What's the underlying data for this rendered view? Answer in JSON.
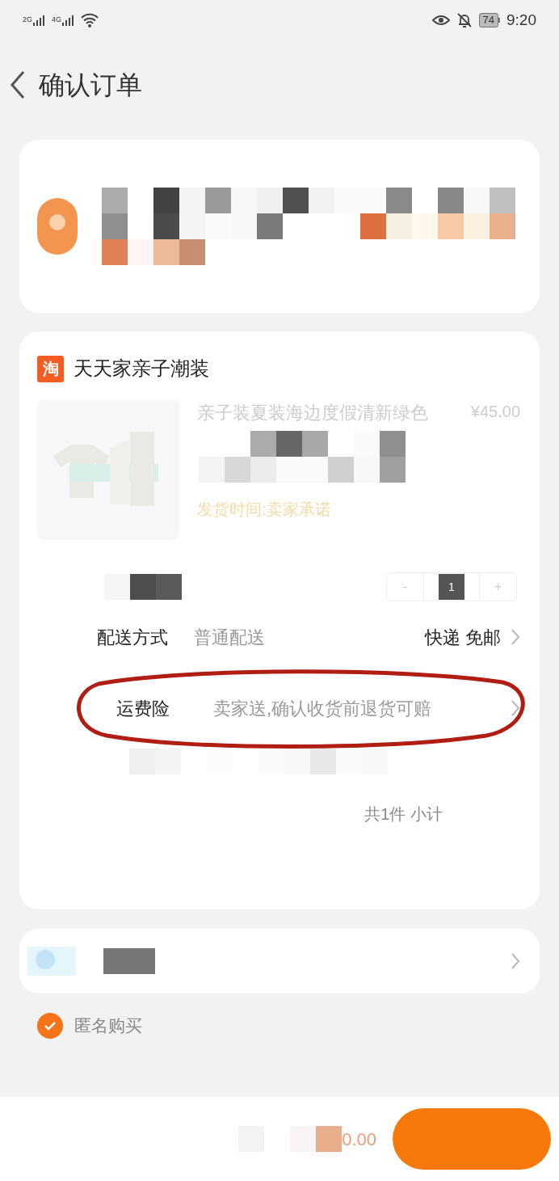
{
  "status_bar": {
    "networks": [
      "2G",
      "4G"
    ],
    "battery": "74",
    "time": "9:20"
  },
  "header": {
    "title": "确认订单"
  },
  "shop": {
    "name": "天天家亲子潮装",
    "badge": "淘"
  },
  "product": {
    "title": "亲子装夏装海边度假清新绿色",
    "price": "¥45.00",
    "shipping_time": "发货时间:卖家承诺",
    "quantity": {
      "minus": "-",
      "value": "1",
      "plus": "+"
    }
  },
  "rows": [
    {
      "label": "配送方式",
      "value": "普通配送",
      "extra": "快递 免邮",
      "highlighted": false
    },
    {
      "label": "运费险",
      "value": "卖家送,确认收货前退货可赔",
      "extra": "",
      "highlighted": true
    }
  ],
  "summary": "共1件 小计",
  "anonymous": {
    "label": "匿名购买",
    "checked": true
  },
  "total_fragment": "0.00"
}
